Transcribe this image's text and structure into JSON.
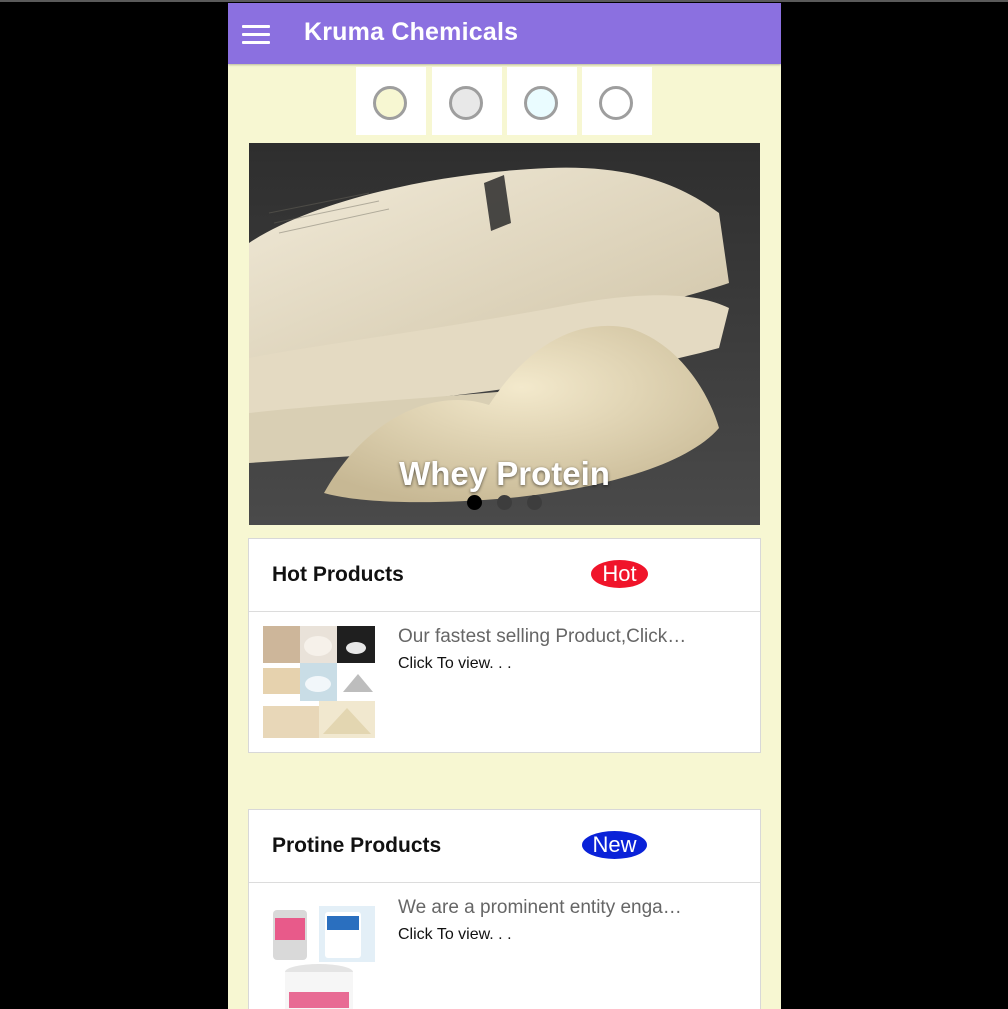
{
  "app": {
    "title": "Kruma Chemicals"
  },
  "colors": {
    "appbar": "#8b70e0",
    "background": "#f7f7d2",
    "hot_badge": "#f0142a",
    "new_badge": "#0a22d8"
  },
  "theme_swatches": [
    {
      "name": "cream",
      "fill": "#f7f7d2"
    },
    {
      "name": "light-gray",
      "fill": "#e8e8e8"
    },
    {
      "name": "light-cyan",
      "fill": "#eafcff"
    },
    {
      "name": "white",
      "fill": "#ffffff"
    }
  ],
  "slider": {
    "caption": "Whey Protein",
    "slide_count": 3,
    "active_index": 0
  },
  "cards": [
    {
      "title": "Hot Products",
      "badge": "Hot",
      "description": "Our fastest selling Product,Click…",
      "link": "Click To view. . ."
    },
    {
      "title": "Protine Products",
      "badge": "New",
      "description": "We are a prominent entity enga…",
      "link": "Click To view. . ."
    }
  ],
  "icons": {
    "menu": "hamburger-menu-icon"
  }
}
